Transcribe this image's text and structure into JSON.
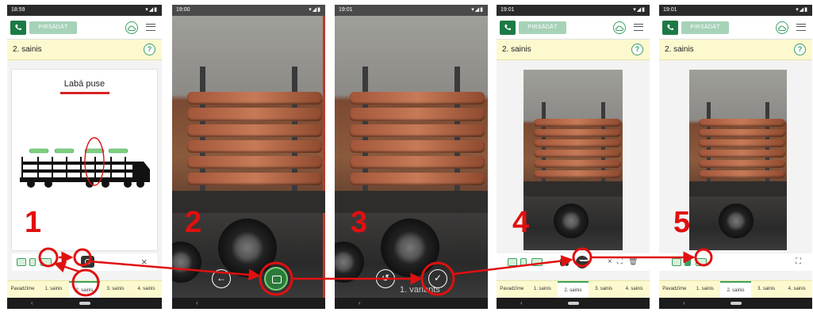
{
  "brand": {
    "accent": "#3aa163",
    "dark_green": "#1c7a45",
    "annotation_red": "#e01010",
    "tab_bg": "#fcf9cf"
  },
  "app": {
    "sign_button_label": "PIRSĀDĀT",
    "section_title": "2. sainis",
    "side_label": "Labā puse",
    "tabs": [
      "Pavadzīme",
      "1. sainis",
      "2. sainis",
      "3. sainis",
      "4. sainis"
    ],
    "active_tab": "2. sainis",
    "variant_label": "1. variants"
  },
  "screens": [
    {
      "time": "18:59",
      "step": "1"
    },
    {
      "time": "19:00",
      "step": "2"
    },
    {
      "time": "19:01",
      "step": "3"
    },
    {
      "time": "19:01",
      "step": "4"
    },
    {
      "time": "19:01",
      "step": "5"
    }
  ],
  "icons": [
    "phone-icon",
    "cloud-icon",
    "menu-icon",
    "help-icon",
    "camera-icon",
    "close-icon",
    "back-arrow-icon",
    "shutter-icon",
    "retake-icon",
    "confirm-check-icon",
    "upload-icon",
    "delete-icon",
    "fullscreen-icon",
    "signal-icon",
    "battery-icon"
  ]
}
